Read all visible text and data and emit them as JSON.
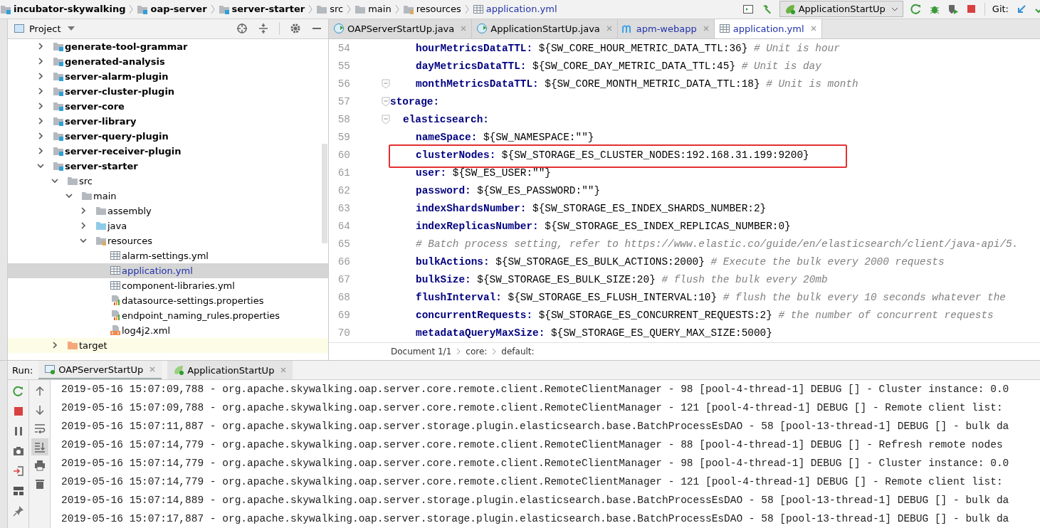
{
  "breadcrumb": [
    {
      "label": "incubator-skywalking",
      "kind": "module"
    },
    {
      "label": "oap-server",
      "kind": "module"
    },
    {
      "label": "server-starter",
      "kind": "module"
    },
    {
      "label": "src",
      "kind": "folder"
    },
    {
      "label": "main",
      "kind": "folder"
    },
    {
      "label": "resources",
      "kind": "resource-folder"
    },
    {
      "label": "application.yml",
      "kind": "yml"
    }
  ],
  "toolbar": {
    "run_config": "ApplicationStartUp",
    "git_label": "Git:"
  },
  "project_panel": {
    "title": "Project",
    "tree": [
      {
        "label": "generate-tool-grammar",
        "kind": "module",
        "expanded": false,
        "selected": false
      },
      {
        "label": "generated-analysis",
        "kind": "module",
        "expanded": false,
        "selected": false
      },
      {
        "label": "server-alarm-plugin",
        "kind": "module",
        "expanded": false,
        "selected": false
      },
      {
        "label": "server-cluster-plugin",
        "kind": "module",
        "expanded": false,
        "selected": false
      },
      {
        "label": "server-core",
        "kind": "module",
        "expanded": false,
        "selected": false
      },
      {
        "label": "server-library",
        "kind": "module",
        "expanded": false,
        "selected": false
      },
      {
        "label": "server-query-plugin",
        "kind": "module",
        "expanded": false,
        "selected": false
      },
      {
        "label": "server-receiver-plugin",
        "kind": "module",
        "expanded": false,
        "selected": false
      },
      {
        "label": "server-starter",
        "kind": "module",
        "expanded": true,
        "selected": false,
        "children": [
          {
            "label": "src",
            "kind": "folder",
            "expanded": true,
            "selected": false,
            "children": [
              {
                "label": "main",
                "kind": "folder",
                "expanded": true,
                "selected": false,
                "children": [
                  {
                    "label": "assembly",
                    "kind": "folder",
                    "expanded": false,
                    "selected": false
                  },
                  {
                    "label": "java",
                    "kind": "source-folder",
                    "expanded": false,
                    "selected": false
                  },
                  {
                    "label": "resources",
                    "kind": "resource-folder",
                    "expanded": true,
                    "selected": false,
                    "children": [
                      {
                        "label": "alarm-settings.yml",
                        "kind": "yml",
                        "selected": false
                      },
                      {
                        "label": "application.yml",
                        "kind": "yml",
                        "selected": true
                      },
                      {
                        "label": "component-libraries.yml",
                        "kind": "yml",
                        "selected": false
                      },
                      {
                        "label": "datasource-settings.properties",
                        "kind": "properties",
                        "selected": false
                      },
                      {
                        "label": "endpoint_naming_rules.properties",
                        "kind": "properties",
                        "selected": false
                      },
                      {
                        "label": "log4j2.xml",
                        "kind": "xml",
                        "selected": false
                      }
                    ]
                  }
                ]
              }
            ]
          },
          {
            "label": "target",
            "kind": "excluded-folder",
            "expanded": false,
            "selected": false
          }
        ]
      }
    ]
  },
  "editor_tabs": [
    {
      "label": "OAPServerStartUp.java",
      "kind": "java-run",
      "selected": false
    },
    {
      "label": "ApplicationStartUp.java",
      "kind": "java-spring",
      "selected": false
    },
    {
      "label": "apm-webapp",
      "kind": "maven",
      "selected": false
    },
    {
      "label": "application.yml",
      "kind": "yml",
      "selected": true
    }
  ],
  "code": [
    {
      "children": [
        {
          "children": [
            {
              "no": "54",
              "key": "hourMetricsDataTTL:",
              "value": "${SW_CORE_HOUR_METRIC_DATA_TTL:36}",
              "comment": "# Unit is hour"
            },
            {
              "no": "55",
              "key": "dayMetricsDataTTL:",
              "value": "${SW_CORE_DAY_METRIC_DATA_TTL:45}",
              "comment": "# Unit is day"
            },
            {
              "no": "56",
              "key": "monthMetricsDataTTL:",
              "value": "${SW_CORE_MONTH_METRIC_DATA_TTL:18}",
              "comment": "# Unit is month",
              "fold": true
            }
          ]
        }
      ]
    },
    {
      "no": "57",
      "key": "storage:",
      "fold": true,
      "children": [
        {
          "no": "58",
          "key": "elasticsearch:",
          "fold": true,
          "children": [
            {
              "no": "59",
              "key": "nameSpace:",
              "value": "${SW_NAMESPACE:\"\"}"
            },
            {
              "no": "60",
              "key": "clusterNodes:",
              "value": "${SW_STORAGE_ES_CLUSTER_NODES:192.168.31.199:9200}"
            },
            {
              "no": "61",
              "key": "user:",
              "value": "${SW_ES_USER:\"\"}"
            },
            {
              "no": "62",
              "key": "password:",
              "value": "${SW_ES_PASSWORD:\"\"}"
            },
            {
              "no": "63",
              "key": "indexShardsNumber:",
              "value": "${SW_STORAGE_ES_INDEX_SHARDS_NUMBER:2}"
            },
            {
              "no": "64",
              "key": "indexReplicasNumber:",
              "value": "${SW_STORAGE_ES_INDEX_REPLICAS_NUMBER:0}"
            },
            {
              "no": "65",
              "comment": "# Batch process setting, refer to https://www.elastic.co/guide/en/elasticsearch/client/java-api/5."
            },
            {
              "no": "66",
              "key": "bulkActions:",
              "value": "${SW_STORAGE_ES_BULK_ACTIONS:2000}",
              "comment": "# Execute the bulk every 2000 requests"
            },
            {
              "no": "67",
              "key": "bulkSize:",
              "value": "${SW_STORAGE_ES_BULK_SIZE:20}",
              "comment": "# flush the bulk every 20mb"
            },
            {
              "no": "68",
              "key": "flushInterval:",
              "value": "${SW_STORAGE_ES_FLUSH_INTERVAL:10}",
              "comment": "# flush the bulk every 10 seconds whatever the"
            },
            {
              "no": "69",
              "key": "concurrentRequests:",
              "value": "${SW_STORAGE_ES_CONCURRENT_REQUESTS:2}",
              "comment": "# the number of concurrent requests"
            },
            {
              "no": "70",
              "key": "metadataQueryMaxSize:",
              "value": "${SW_STORAGE_ES_QUERY_MAX_SIZE:5000}"
            }
          ]
        }
      ]
    }
  ],
  "editor_breadcrumb": [
    "Document 1/1",
    "core:",
    "default:"
  ],
  "run_panel": {
    "label": "Run:",
    "tabs": [
      {
        "label": "OAPServerStartUp",
        "kind": "java-run",
        "selected": true
      },
      {
        "label": "ApplicationStartUp",
        "kind": "java-spring",
        "selected": false
      }
    ],
    "log": [
      "2019-05-16 15:07:09,788 - org.apache.skywalking.oap.server.core.remote.client.RemoteClientManager - 98 [pool-4-thread-1] DEBUG [] - Cluster instance: 0.0",
      "2019-05-16 15:07:09,788 - org.apache.skywalking.oap.server.core.remote.client.RemoteClientManager - 121 [pool-4-thread-1] DEBUG [] - Remote client list:",
      "2019-05-16 15:07:11,887 - org.apache.skywalking.oap.server.storage.plugin.elasticsearch.base.BatchProcessEsDAO - 58 [pool-13-thread-1] DEBUG [] - bulk da",
      "2019-05-16 15:07:14,779 - org.apache.skywalking.oap.server.core.remote.client.RemoteClientManager - 88 [pool-4-thread-1] DEBUG [] - Refresh remote nodes",
      "2019-05-16 15:07:14,779 - org.apache.skywalking.oap.server.core.remote.client.RemoteClientManager - 98 [pool-4-thread-1] DEBUG [] - Cluster instance: 0.0",
      "2019-05-16 15:07:14,779 - org.apache.skywalking.oap.server.core.remote.client.RemoteClientManager - 121 [pool-4-thread-1] DEBUG [] - Remote client list:",
      "2019-05-16 15:07:14,889 - org.apache.skywalking.oap.server.storage.plugin.elasticsearch.base.BatchProcessEsDAO - 58 [pool-13-thread-1] DEBUG [] - bulk da",
      "2019-05-16 15:07:17,887 - org.apache.skywalking.oap.server.storage.plugin.elasticsearch.base.BatchProcessEsDAO - 58 [pool-13-thread-1] DEBUG [] - bulk da"
    ]
  }
}
